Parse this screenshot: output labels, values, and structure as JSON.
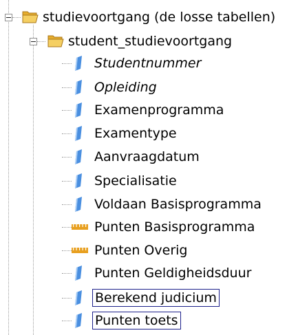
{
  "tree": {
    "root": {
      "label": "studievoortgang (de losse tabellen)",
      "icon": "folder-open-icon",
      "expanded": true
    },
    "child": {
      "label": "student_studievoortgang",
      "icon": "folder-open-icon",
      "expanded": true
    },
    "fields": [
      {
        "label": "Studentnummer",
        "icon": "attribute-icon",
        "italic": true,
        "boxed": false
      },
      {
        "label": "Opleiding",
        "icon": "attribute-icon",
        "italic": true,
        "boxed": false
      },
      {
        "label": "Examenprogramma",
        "icon": "attribute-icon",
        "italic": false,
        "boxed": false
      },
      {
        "label": "Examentype",
        "icon": "attribute-icon",
        "italic": false,
        "boxed": false
      },
      {
        "label": "Aanvraagdatum",
        "icon": "attribute-icon",
        "italic": false,
        "boxed": false
      },
      {
        "label": "Specialisatie",
        "icon": "attribute-icon",
        "italic": false,
        "boxed": false
      },
      {
        "label": "Voldaan Basisprogramma",
        "icon": "attribute-icon",
        "italic": false,
        "boxed": false
      },
      {
        "label": "Punten Basisprogramma",
        "icon": "measure-icon",
        "italic": false,
        "boxed": false
      },
      {
        "label": "Punten Overig",
        "icon": "measure-icon",
        "italic": false,
        "boxed": false
      },
      {
        "label": "Punten Geldigheidsduur",
        "icon": "attribute-icon",
        "italic": false,
        "boxed": false
      },
      {
        "label": "Berekend judicium",
        "icon": "attribute-icon",
        "italic": false,
        "boxed": true
      },
      {
        "label": "Punten toets",
        "icon": "attribute-icon",
        "italic": false,
        "boxed": true
      }
    ]
  },
  "colors": {
    "folder": "#f0c24a",
    "attribute": "#4a8fe0",
    "measure": "#e8a020",
    "selection_border": "#1b1f8a"
  }
}
